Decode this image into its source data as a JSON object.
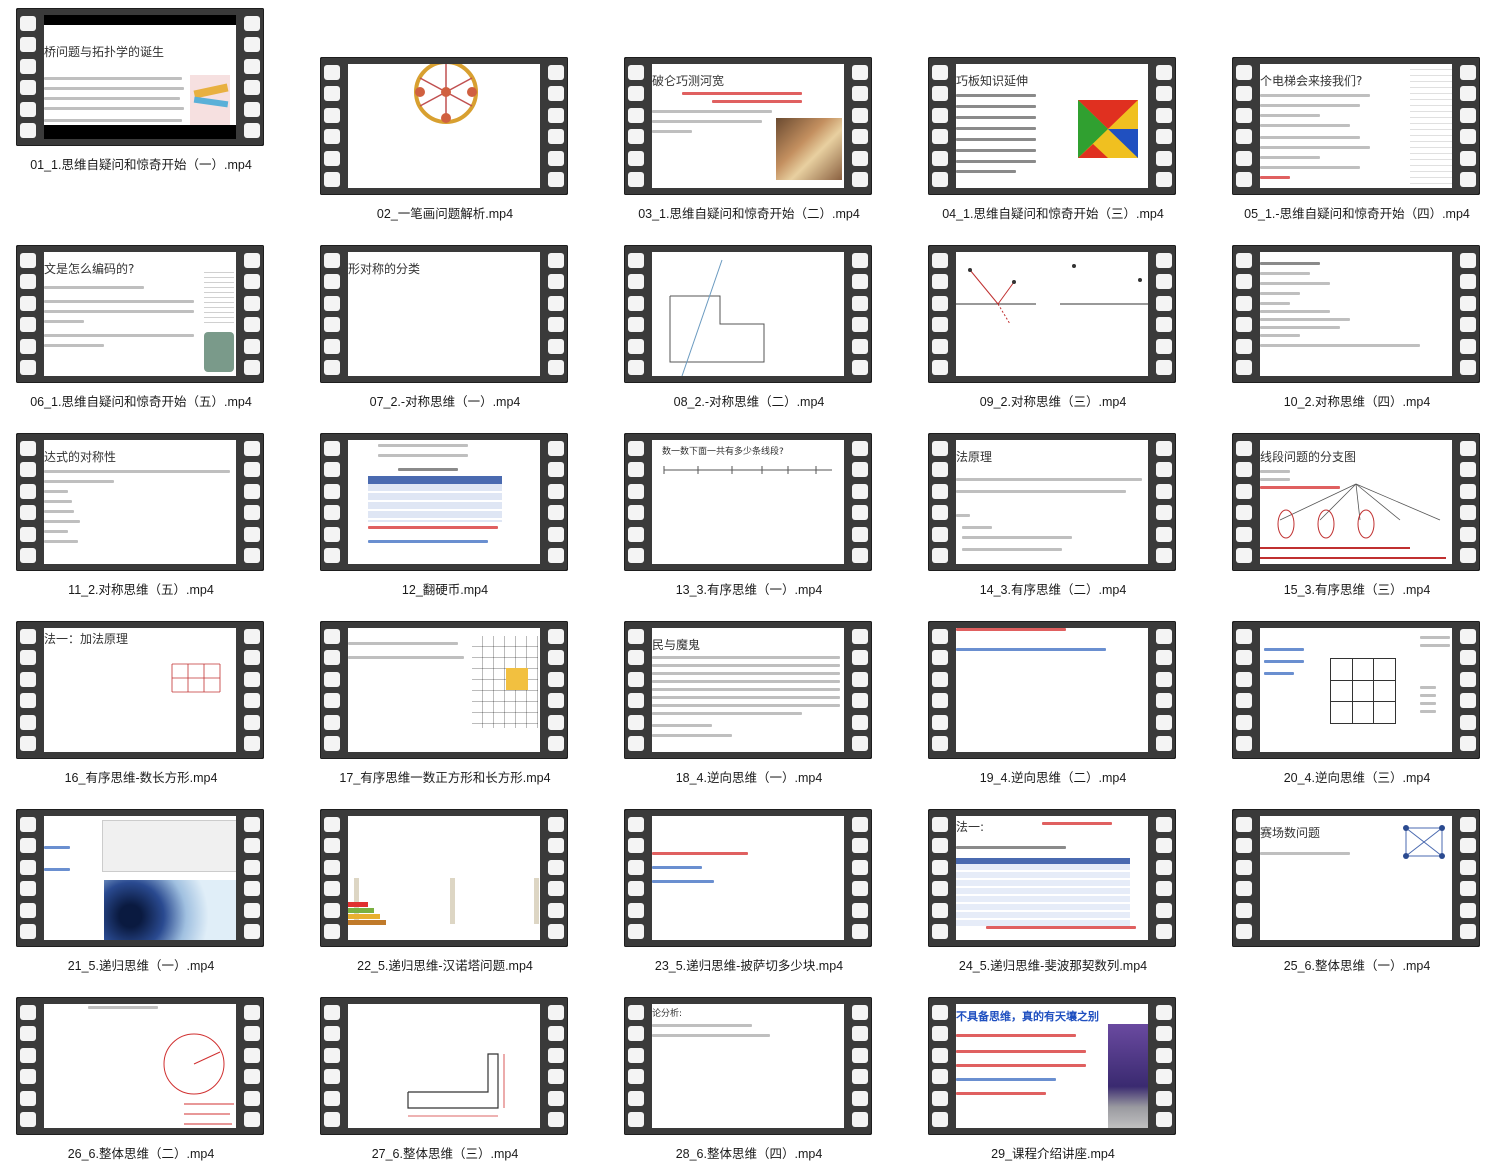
{
  "videos": [
    {
      "caption": "01_1.思维自疑问和惊奇开始（一）.mp4",
      "slide_title": "桥问题与拓扑学的诞生"
    },
    {
      "caption": "02_一笔画问题解析.mp4",
      "slide_title": ""
    },
    {
      "caption": "03_1.思维自疑问和惊奇开始（二）.mp4",
      "slide_title": "破仑巧测河宽"
    },
    {
      "caption": "04_1.思维自疑问和惊奇开始（三）.mp4",
      "slide_title": "巧板知识延伸"
    },
    {
      "caption": "05_1.-思维自疑问和惊奇开始（四）.mp4",
      "slide_title": "个电梯会来接我们?"
    },
    {
      "caption": "06_1.思维自疑问和惊奇开始（五）.mp4",
      "slide_title": "文是怎么编码的?"
    },
    {
      "caption": "07_2.-对称思维（一）.mp4",
      "slide_title": "形对称的分类"
    },
    {
      "caption": "08_2.-对称思维（二）.mp4",
      "slide_title": ""
    },
    {
      "caption": "09_2.对称思维（三）.mp4",
      "slide_title": ""
    },
    {
      "caption": "10_2.对称思维（四）.mp4",
      "slide_title": ""
    },
    {
      "caption": "11_2.对称思维（五）.mp4",
      "slide_title": "达式的对称性"
    },
    {
      "caption": "12_翻硬币.mp4",
      "slide_title": ""
    },
    {
      "caption": "13_3.有序思维（一）.mp4",
      "slide_title": "数一数下面一共有多少条线段?"
    },
    {
      "caption": "14_3.有序思维（二）.mp4",
      "slide_title": "法原理"
    },
    {
      "caption": "15_3.有序思维（三）.mp4",
      "slide_title": "线段问题的分支图"
    },
    {
      "caption": "16_有序思维-数长方形.mp4",
      "slide_title": "法一：加法原理"
    },
    {
      "caption": "17_有序思维一数正方形和长方形.mp4",
      "slide_title": ""
    },
    {
      "caption": "18_4.逆向思维（一）.mp4",
      "slide_title": "民与魔鬼"
    },
    {
      "caption": "19_4.逆向思维（二）.mp4",
      "slide_title": ""
    },
    {
      "caption": "20_4.逆向思维（三）.mp4",
      "slide_title": ""
    },
    {
      "caption": "21_5.递归思维（一）.mp4",
      "slide_title": ""
    },
    {
      "caption": "22_5.递归思维-汉诺塔问题.mp4",
      "slide_title": ""
    },
    {
      "caption": "23_5.递归思维-披萨切多少块.mp4",
      "slide_title": ""
    },
    {
      "caption": "24_5.递归思维-斐波那契数列.mp4",
      "slide_title": "法一:"
    },
    {
      "caption": "25_6.整体思维（一）.mp4",
      "slide_title": "赛场数问题"
    },
    {
      "caption": "26_6.整体思维（二）.mp4",
      "slide_title": ""
    },
    {
      "caption": "27_6.整体思维（三）.mp4",
      "slide_title": ""
    },
    {
      "caption": "28_6.整体思维（四）.mp4",
      "slide_title": "论分析:"
    },
    {
      "caption": "29_课程介绍讲座.mp4",
      "slide_title": "不具备思维，真的有天壤之别"
    }
  ],
  "colors": {
    "film": "#3a3a3a",
    "hole": "#f4f4f4",
    "accent_red": "#e03030",
    "accent_blue": "#3060c0"
  }
}
